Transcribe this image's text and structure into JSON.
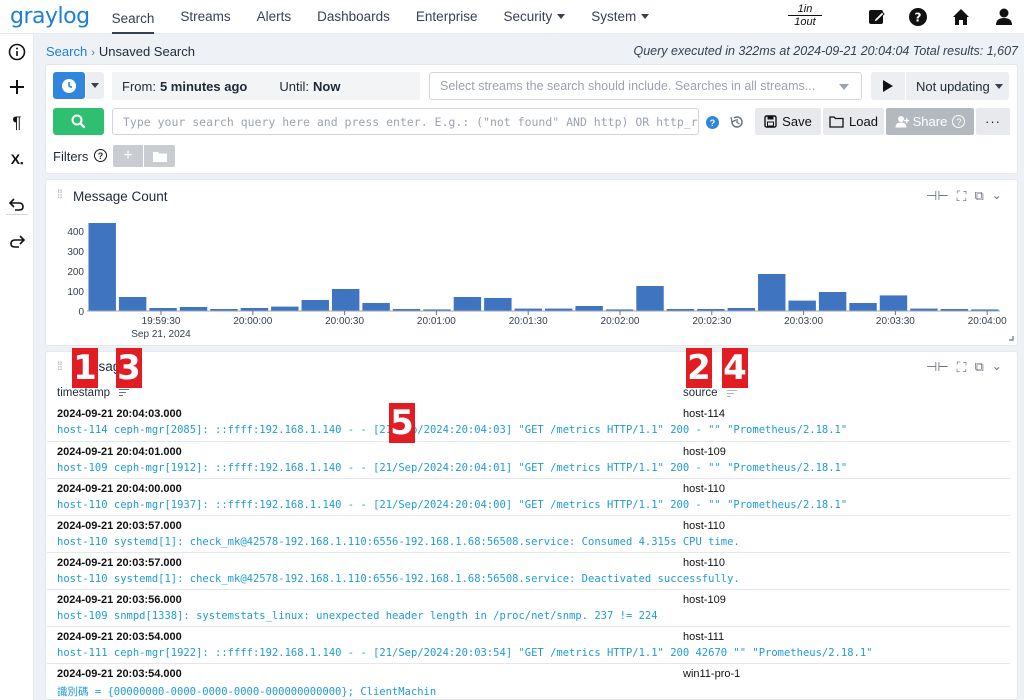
{
  "app": {
    "logo": "graylog"
  },
  "nav": {
    "items": [
      {
        "label": "Search",
        "active": true,
        "dropdown": false
      },
      {
        "label": "Streams",
        "active": false,
        "dropdown": false
      },
      {
        "label": "Alerts",
        "active": false,
        "dropdown": false
      },
      {
        "label": "Dashboards",
        "active": false,
        "dropdown": false
      },
      {
        "label": "Enterprise",
        "active": false,
        "dropdown": false
      },
      {
        "label": "Security",
        "active": false,
        "dropdown": true
      },
      {
        "label": "System",
        "active": false,
        "dropdown": true
      }
    ],
    "throughput_in": "1in",
    "throughput_out": "1out",
    "icons": [
      "edit-icon",
      "help-icon",
      "home-icon",
      "user-icon"
    ]
  },
  "breadcrumb": {
    "root": "Search",
    "current": "Unsaved Search"
  },
  "query_info": "Query executed in 322ms at 2024-09-21 20:04:04 Total results: 1,607",
  "search": {
    "from_label": "From:",
    "from_value": "5 minutes ago",
    "until_label": "Until:",
    "until_value": "Now",
    "streams_placeholder": "Select streams the search should include. Searches in all streams...",
    "refresh_label": "Not updating",
    "query_placeholder": "Type your search query here and press enter. E.g.: (\"not found\" AND http) OR http_resp...",
    "save_label": "Save",
    "load_label": "Load",
    "share_label": "Share",
    "more_label": "···",
    "filters_label": "Filters"
  },
  "message_count": {
    "title": "Message Count",
    "date_label": "Sep 21, 2024"
  },
  "chart_data": {
    "type": "bar",
    "title": "Message Count",
    "ylim": [
      0,
      450
    ],
    "yticks": [
      0,
      100,
      200,
      300,
      400
    ],
    "xticks": [
      "19:59:30",
      "20:00:00",
      "20:00:30",
      "20:01:00",
      "20:01:30",
      "20:02:00",
      "20:02:30",
      "20:03:00",
      "20:03:30",
      "20:04:00"
    ],
    "values": [
      440,
      70,
      15,
      20,
      10,
      15,
      22,
      55,
      110,
      40,
      10,
      8,
      70,
      65,
      12,
      12,
      25,
      8,
      125,
      10,
      10,
      15,
      185,
      52,
      95,
      40,
      78,
      12,
      10,
      8
    ],
    "color": "#3f74c0"
  },
  "messages": {
    "title": "Messages",
    "columns": [
      "timestamp",
      "source"
    ],
    "rows": [
      {
        "timestamp": "2024-09-21 20:04:03.000",
        "source": "host-114",
        "message": "host-114 ceph-mgr[2085]: ::ffff:192.168.1.140 - - [21/Sep/2024:20:04:03] \"GET /metrics HTTP/1.1\" 200 - \"\" \"Prometheus/2.18.1\""
      },
      {
        "timestamp": "2024-09-21 20:04:01.000",
        "source": "host-109",
        "message": "host-109 ceph-mgr[1912]: ::ffff:192.168.1.140 - - [21/Sep/2024:20:04:01] \"GET /metrics HTTP/1.1\" 200 - \"\" \"Prometheus/2.18.1\""
      },
      {
        "timestamp": "2024-09-21 20:04:00.000",
        "source": "host-110",
        "message": "host-110 ceph-mgr[1937]: ::ffff:192.168.1.140 - - [21/Sep/2024:20:04:00] \"GET /metrics HTTP/1.1\" 200 - \"\" \"Prometheus/2.18.1\""
      },
      {
        "timestamp": "2024-09-21 20:03:57.000",
        "source": "host-110",
        "message": "host-110 systemd[1]: check_mk@42578-192.168.1.110:6556-192.168.1.68:56508.service: Consumed 4.315s CPU time."
      },
      {
        "timestamp": "2024-09-21 20:03:57.000",
        "source": "host-110",
        "message": "host-110 systemd[1]: check_mk@42578-192.168.1.110:6556-192.168.1.68:56508.service: Deactivated successfully."
      },
      {
        "timestamp": "2024-09-21 20:03:56.000",
        "source": "host-109",
        "message": "host-109 snmpd[1338]: systemstats_linux: unexpected header length in /proc/net/snmp. 237 != 224"
      },
      {
        "timestamp": "2024-09-21 20:03:54.000",
        "source": "host-111",
        "message": "host-111 ceph-mgr[1922]: ::ffff:192.168.1.140 - - [21/Sep/2024:20:03:54] \"GET /metrics HTTP/1.1\" 200 42670 \"\" \"Prometheus/2.18.1\""
      },
      {
        "timestamp": "2024-09-21 20:03:54.000",
        "source": "win11-pro-1",
        "message": "識別碼 = {00000000-0000-0000-0000-000000000000}; ClientMachin"
      }
    ]
  },
  "markers": [
    "1",
    "2",
    "3",
    "4",
    "5"
  ]
}
